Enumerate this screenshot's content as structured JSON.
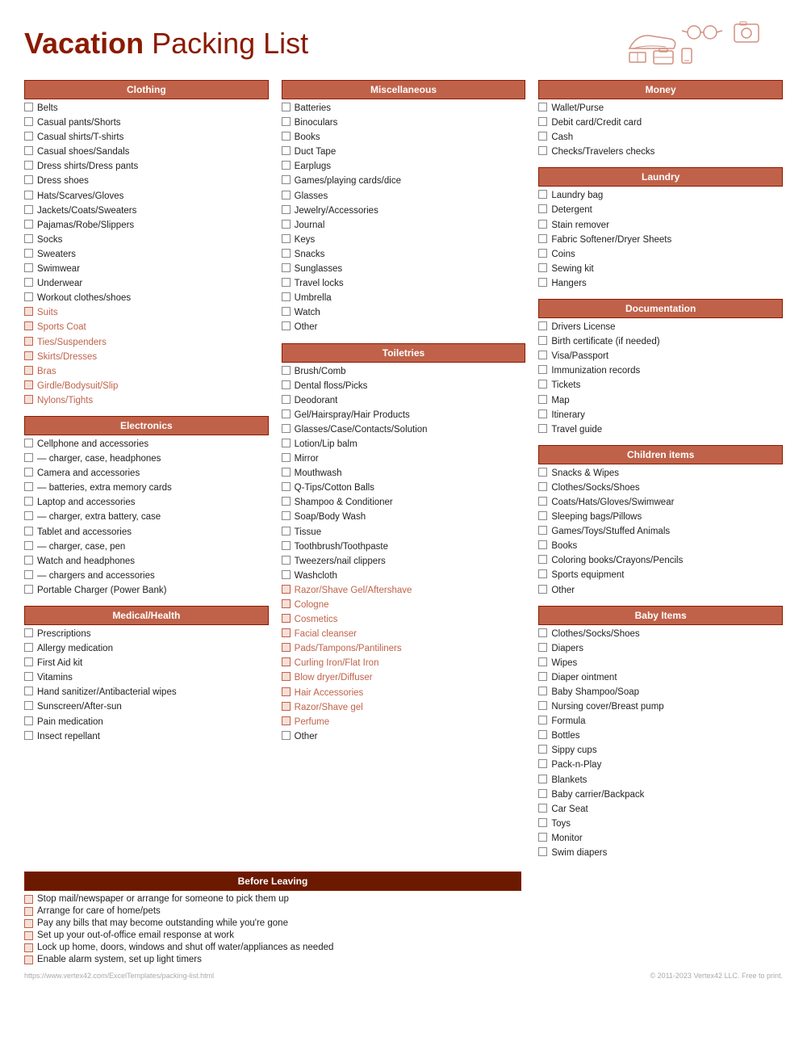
{
  "header": {
    "title_bold": "Vacation",
    "title_rest": " Packing List"
  },
  "footer": {
    "left": "https://www.vertex42.com/ExcelTemplates/packing-list.html",
    "right": "© 2011-2023 Vertex42 LLC. Free to print."
  },
  "sections": {
    "clothing": {
      "label": "Clothing",
      "items": [
        {
          "text": "Belts",
          "optional": false
        },
        {
          "text": "Casual pants/Shorts",
          "optional": false
        },
        {
          "text": "Casual shirts/T-shirts",
          "optional": false
        },
        {
          "text": "Casual shoes/Sandals",
          "optional": false
        },
        {
          "text": "Dress shirts/Dress pants",
          "optional": false
        },
        {
          "text": "Dress shoes",
          "optional": false
        },
        {
          "text": "Hats/Scarves/Gloves",
          "optional": false
        },
        {
          "text": "Jackets/Coats/Sweaters",
          "optional": false
        },
        {
          "text": "Pajamas/Robe/Slippers",
          "optional": false
        },
        {
          "text": "Socks",
          "optional": false
        },
        {
          "text": "Sweaters",
          "optional": false
        },
        {
          "text": "Swimwear",
          "optional": false
        },
        {
          "text": "Underwear",
          "optional": false
        },
        {
          "text": "Workout clothes/shoes",
          "optional": false
        },
        {
          "text": "Suits",
          "optional": true
        },
        {
          "text": "Sports Coat",
          "optional": true
        },
        {
          "text": "Ties/Suspenders",
          "optional": true
        },
        {
          "text": "Skirts/Dresses",
          "optional": true
        },
        {
          "text": "Bras",
          "optional": true
        },
        {
          "text": "Girdle/Bodysuit/Slip",
          "optional": true
        },
        {
          "text": "Nylons/Tights",
          "optional": true
        }
      ]
    },
    "electronics": {
      "label": "Electronics",
      "items": [
        {
          "text": "Cellphone and accessories",
          "optional": false
        },
        {
          "text": "— charger, case, headphones",
          "optional": false
        },
        {
          "text": "Camera and accessories",
          "optional": false
        },
        {
          "text": "— batteries, extra memory cards",
          "optional": false
        },
        {
          "text": "Laptop and accessories",
          "optional": false
        },
        {
          "text": "— charger, extra battery, case",
          "optional": false
        },
        {
          "text": "Tablet and accessories",
          "optional": false
        },
        {
          "text": "— charger, case, pen",
          "optional": false
        },
        {
          "text": "Watch and headphones",
          "optional": false
        },
        {
          "text": "— chargers and accessories",
          "optional": false
        },
        {
          "text": "Portable Charger (Power Bank)",
          "optional": false
        }
      ]
    },
    "medical": {
      "label": "Medical/Health",
      "items": [
        {
          "text": "Prescriptions",
          "optional": false
        },
        {
          "text": "Allergy medication",
          "optional": false
        },
        {
          "text": "First Aid kit",
          "optional": false
        },
        {
          "text": "Vitamins",
          "optional": false
        },
        {
          "text": "Hand sanitizer/Antibacterial wipes",
          "optional": false
        },
        {
          "text": "Sunscreen/After-sun",
          "optional": false
        },
        {
          "text": "Pain medication",
          "optional": false
        },
        {
          "text": "Insect repellant",
          "optional": false
        }
      ]
    },
    "miscellaneous": {
      "label": "Miscellaneous",
      "items": [
        {
          "text": "Batteries",
          "optional": false
        },
        {
          "text": "Binoculars",
          "optional": false
        },
        {
          "text": "Books",
          "optional": false
        },
        {
          "text": "Duct Tape",
          "optional": false
        },
        {
          "text": "Earplugs",
          "optional": false
        },
        {
          "text": "Games/playing cards/dice",
          "optional": false
        },
        {
          "text": "Glasses",
          "optional": false
        },
        {
          "text": "Jewelry/Accessories",
          "optional": false
        },
        {
          "text": "Journal",
          "optional": false
        },
        {
          "text": "Keys",
          "optional": false
        },
        {
          "text": "Snacks",
          "optional": false
        },
        {
          "text": "Sunglasses",
          "optional": false
        },
        {
          "text": "Travel locks",
          "optional": false
        },
        {
          "text": "Umbrella",
          "optional": false
        },
        {
          "text": "Watch",
          "optional": false
        },
        {
          "text": "Other",
          "optional": false
        }
      ]
    },
    "toiletries": {
      "label": "Toiletries",
      "items": [
        {
          "text": "Brush/Comb",
          "optional": false
        },
        {
          "text": "Dental floss/Picks",
          "optional": false
        },
        {
          "text": "Deodorant",
          "optional": false
        },
        {
          "text": "Gel/Hairspray/Hair Products",
          "optional": false
        },
        {
          "text": "Glasses/Case/Contacts/Solution",
          "optional": false
        },
        {
          "text": "Lotion/Lip balm",
          "optional": false
        },
        {
          "text": "Mirror",
          "optional": false
        },
        {
          "text": "Mouthwash",
          "optional": false
        },
        {
          "text": "Q-Tips/Cotton Balls",
          "optional": false
        },
        {
          "text": "Shampoo & Conditioner",
          "optional": false
        },
        {
          "text": "Soap/Body Wash",
          "optional": false
        },
        {
          "text": "Tissue",
          "optional": false
        },
        {
          "text": "Toothbrush/Toothpaste",
          "optional": false
        },
        {
          "text": "Tweezers/nail clippers",
          "optional": false
        },
        {
          "text": "Washcloth",
          "optional": false
        },
        {
          "text": "Razor/Shave Gel/Aftershave",
          "optional": true
        },
        {
          "text": "Cologne",
          "optional": true
        },
        {
          "text": "Cosmetics",
          "optional": true
        },
        {
          "text": "Facial cleanser",
          "optional": true
        },
        {
          "text": "Pads/Tampons/Pantiliners",
          "optional": true
        },
        {
          "text": "Curling Iron/Flat Iron",
          "optional": true
        },
        {
          "text": "Blow dryer/Diffuser",
          "optional": true
        },
        {
          "text": "Hair Accessories",
          "optional": true
        },
        {
          "text": "Razor/Shave gel",
          "optional": true
        },
        {
          "text": "Perfume",
          "optional": true
        },
        {
          "text": "Other",
          "optional": false
        }
      ]
    },
    "money": {
      "label": "Money",
      "items": [
        {
          "text": "Wallet/Purse",
          "optional": false
        },
        {
          "text": "Debit card/Credit card",
          "optional": false
        },
        {
          "text": "Cash",
          "optional": false
        },
        {
          "text": "Checks/Travelers checks",
          "optional": false
        }
      ]
    },
    "laundry": {
      "label": "Laundry",
      "items": [
        {
          "text": "Laundry bag",
          "optional": false
        },
        {
          "text": "Detergent",
          "optional": false
        },
        {
          "text": "Stain remover",
          "optional": false
        },
        {
          "text": "Fabric Softener/Dryer Sheets",
          "optional": false
        },
        {
          "text": "Coins",
          "optional": false
        },
        {
          "text": "Sewing kit",
          "optional": false
        },
        {
          "text": "Hangers",
          "optional": false
        }
      ]
    },
    "documentation": {
      "label": "Documentation",
      "items": [
        {
          "text": "Drivers License",
          "optional": false
        },
        {
          "text": "Birth certificate (if needed)",
          "optional": false
        },
        {
          "text": "Visa/Passport",
          "optional": false
        },
        {
          "text": "Immunization records",
          "optional": false
        },
        {
          "text": "Tickets",
          "optional": false
        },
        {
          "text": "Map",
          "optional": false
        },
        {
          "text": "Itinerary",
          "optional": false
        },
        {
          "text": "Travel guide",
          "optional": false
        }
      ]
    },
    "children": {
      "label": "Children items",
      "items": [
        {
          "text": "Snacks & Wipes",
          "optional": false
        },
        {
          "text": "Clothes/Socks/Shoes",
          "optional": false
        },
        {
          "text": "Coats/Hats/Gloves/Swimwear",
          "optional": false
        },
        {
          "text": "Sleeping bags/Pillows",
          "optional": false
        },
        {
          "text": "Games/Toys/Stuffed Animals",
          "optional": false
        },
        {
          "text": "Books",
          "optional": false
        },
        {
          "text": "Coloring books/Crayons/Pencils",
          "optional": false
        },
        {
          "text": "Sports equipment",
          "optional": false
        },
        {
          "text": "Other",
          "optional": false
        }
      ]
    },
    "baby": {
      "label": "Baby Items",
      "items": [
        {
          "text": "Clothes/Socks/Shoes",
          "optional": false
        },
        {
          "text": "Diapers",
          "optional": false
        },
        {
          "text": "Wipes",
          "optional": false
        },
        {
          "text": "Diaper ointment",
          "optional": false
        },
        {
          "text": "Baby Shampoo/Soap",
          "optional": false
        },
        {
          "text": "Nursing cover/Breast pump",
          "optional": false
        },
        {
          "text": "Formula",
          "optional": false
        },
        {
          "text": "Bottles",
          "optional": false
        },
        {
          "text": "Sippy cups",
          "optional": false
        },
        {
          "text": "Pack-n-Play",
          "optional": false
        },
        {
          "text": "Blankets",
          "optional": false
        },
        {
          "text": "Baby carrier/Backpack",
          "optional": false
        },
        {
          "text": "Car Seat",
          "optional": false
        },
        {
          "text": "Toys",
          "optional": false
        },
        {
          "text": "Monitor",
          "optional": false
        },
        {
          "text": "Swim diapers",
          "optional": false
        }
      ]
    },
    "before_leaving": {
      "label": "Before Leaving",
      "items": [
        "Stop mail/newspaper or arrange for someone to pick them up",
        "Arrange for care of home/pets",
        "Pay any bills that may become outstanding while you're gone",
        "Set up your out-of-office email response at work",
        "Lock up home, doors, windows and shut off water/appliances as needed",
        "Enable alarm system, set up light timers"
      ]
    }
  }
}
